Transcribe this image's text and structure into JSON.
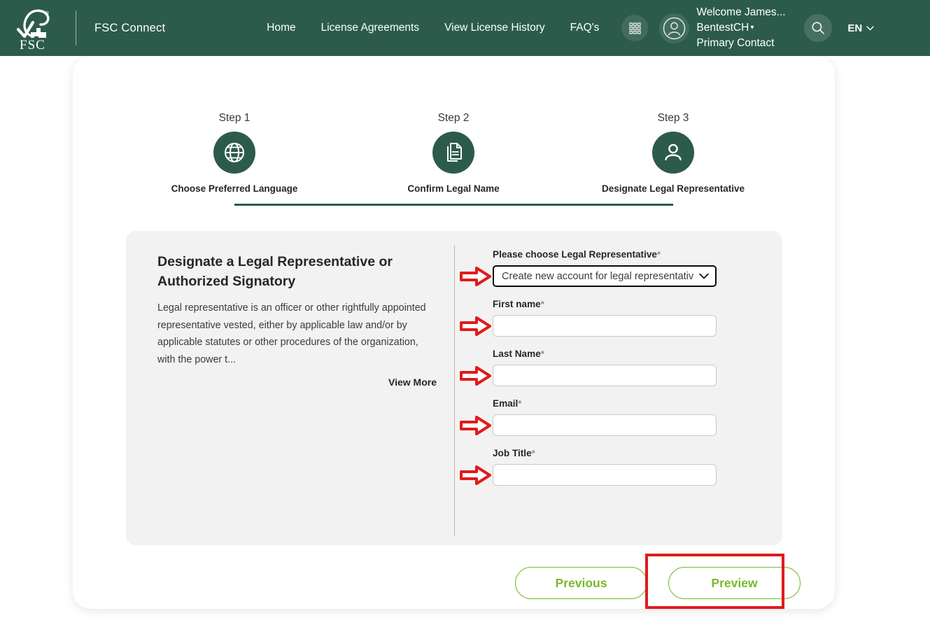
{
  "header": {
    "logo_icon": "fsc-tree-checkmark-logo",
    "logo_text": "FSC",
    "registered_mark": "®",
    "brand": "FSC Connect",
    "nav": [
      {
        "label": "Home",
        "name": "nav-home"
      },
      {
        "label": "License Agreements",
        "name": "nav-license-agreements"
      },
      {
        "label": "View License History",
        "name": "nav-view-license-history"
      },
      {
        "label": "FAQ's",
        "name": "nav-faqs"
      }
    ],
    "apps_icon": "grid-apps-icon",
    "avatar_icon": "user-avatar-icon",
    "welcome_line1": "Welcome James...",
    "welcome_line2": "BentestCH",
    "welcome_caret": "▾",
    "welcome_line3": "Primary Contact",
    "search_icon": "search-icon",
    "language": "EN",
    "language_caret": "⌄",
    "bg_color": "#2c5b4c"
  },
  "stepper": {
    "steps": [
      {
        "number": "Step 1",
        "label": "Choose Preferred Language",
        "icon": "globe-icon"
      },
      {
        "number": "Step 2",
        "label": "Confirm Legal Name",
        "icon": "documents-icon"
      },
      {
        "number": "Step 3",
        "label": "Designate Legal Representative",
        "icon": "person-icon"
      }
    ],
    "accent_color": "#2c5b4c"
  },
  "info": {
    "title": "Designate a Legal Representative or Authorized Signatory",
    "body": "Legal representative is an officer or other rightfully appointed representative vested, either by applicable law and/or by applicable statutes or other procedures of the organization, with the power t...",
    "view_more": "View More"
  },
  "form": {
    "required_marker": "*",
    "fields": [
      {
        "name": "legal-representative-select",
        "label": "Please choose Legal Representative",
        "type": "select",
        "value": "Create new account for legal representativ",
        "chevron": "chevron-down-icon",
        "focused": true
      },
      {
        "name": "first-name-input",
        "label": "First name",
        "type": "text",
        "value": "",
        "placeholder": ""
      },
      {
        "name": "last-name-input",
        "label": "Last Name",
        "type": "text",
        "value": "",
        "placeholder": ""
      },
      {
        "name": "email-input",
        "label": "Email",
        "type": "text",
        "value": "",
        "placeholder": ""
      },
      {
        "name": "job-title-input",
        "label": "Job Title",
        "type": "text",
        "value": "",
        "placeholder": ""
      }
    ]
  },
  "footer": {
    "previous_label": "Previous",
    "preview_label": "Preview",
    "button_color": "#7ab929",
    "highlight_color": "#e01b1b"
  },
  "annotations": {
    "arrow_icon": "red-pointer-arrow-icon",
    "arrow_color": "#e01b1b",
    "highlight_target": "Preview"
  }
}
